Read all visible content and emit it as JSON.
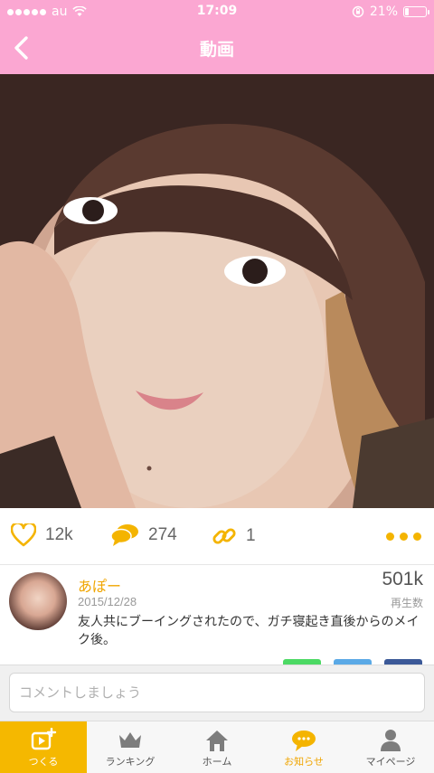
{
  "status": {
    "carrier": "au",
    "time": "17:09",
    "battery": "21%",
    "battery_level": 0.21
  },
  "nav": {
    "title": "動画",
    "back_icon": "chevron-left-icon"
  },
  "actions": {
    "likes": "12k",
    "comments": "274",
    "links": "1"
  },
  "user": {
    "name": "あぽー",
    "date": "2015/12/28",
    "plays": "501k",
    "plays_label": "再生数",
    "description": "友人共にブーイングされたので、ガチ寝起き直後からのメイク後。"
  },
  "share_colors": [
    "#4cd964",
    "#5aa9e6",
    "#3b5998"
  ],
  "comment": {
    "placeholder": "コメントしましょう"
  },
  "tabs": [
    {
      "label": "つくる",
      "icon": "create-video-icon"
    },
    {
      "label": "ランキング",
      "icon": "crown-icon"
    },
    {
      "label": "ホーム",
      "icon": "home-icon"
    },
    {
      "label": "お知らせ",
      "icon": "speech-bubble-icon"
    },
    {
      "label": "マイページ",
      "icon": "person-icon"
    }
  ],
  "colors": {
    "header": "#fba7d2",
    "accent": "#f4b400"
  }
}
